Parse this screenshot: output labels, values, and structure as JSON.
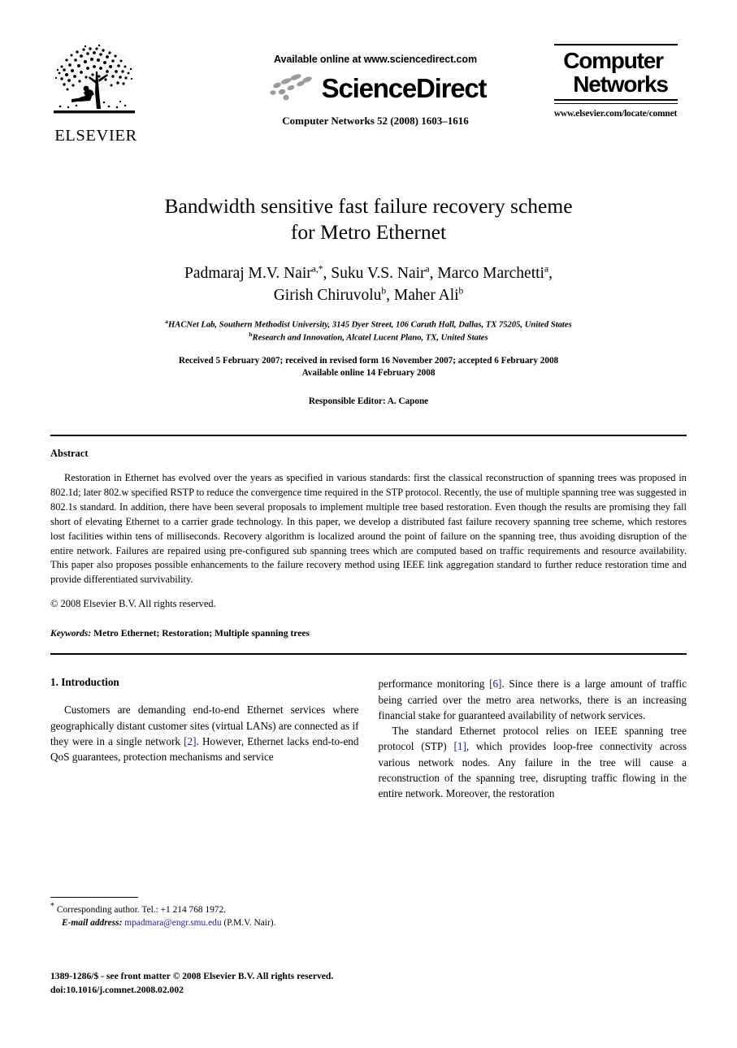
{
  "header": {
    "elsevier_wordmark": "ELSEVIER",
    "available_online": "Available online at www.sciencedirect.com",
    "sciencedirect_wordmark": "ScienceDirect",
    "journal_citation": "Computer Networks 52 (2008) 1603–1616",
    "journal_logo_line1": "Computer",
    "journal_logo_line2": "Networks",
    "journal_url": "www.elsevier.com/locate/comnet"
  },
  "title": {
    "line1": "Bandwidth sensitive fast failure recovery scheme",
    "line2": "for Metro Ethernet"
  },
  "authors": {
    "line1_parts": [
      {
        "name": "Padmaraj M.V. Nair",
        "sup": "a,*"
      },
      {
        "name": "Suku V.S. Nair",
        "sup": "a"
      },
      {
        "name": "Marco Marchetti",
        "sup": "a"
      }
    ],
    "line2_parts": [
      {
        "name": "Girish Chiruvolu",
        "sup": "b"
      },
      {
        "name": "Maher Ali",
        "sup": "b"
      }
    ]
  },
  "affiliations": [
    {
      "marker": "a",
      "text": "HACNet Lab, Southern Methodist University, 3145 Dyer Street, 106 Caruth Hall, Dallas, TX 75205, United States"
    },
    {
      "marker": "b",
      "text": "Research and Innovation, Alcatel Lucent Plano, TX, United States"
    }
  ],
  "history": {
    "received": "Received 5 February 2007; received in revised form 16 November 2007; accepted 6 February 2008",
    "available": "Available online 14 February 2008",
    "editor": "Responsible Editor: A. Capone"
  },
  "abstract": {
    "heading": "Abstract",
    "body": "Restoration in Ethernet has evolved over the years as specified in various standards: first the classical reconstruction of spanning trees was proposed in 802.1d; later 802.w specified RSTP to reduce the convergence time required in the STP protocol. Recently, the use of multiple spanning tree was suggested in 802.1s standard. In addition, there have been several proposals to implement multiple tree based restoration. Even though the results are promising they fall short of elevating Ethernet to a carrier grade technology. In this paper, we develop a distributed fast failure recovery spanning tree scheme, which restores lost facilities within tens of milliseconds. Recovery algorithm is localized around the point of failure on the spanning tree, thus avoiding disruption of the entire network. Failures are repaired using pre-configured sub spanning trees which are computed based on traffic requirements and resource availability. This paper also proposes possible enhancements to the failure recovery method using IEEE link aggregation standard to further reduce restoration time and provide differentiated survivability.",
    "copyright": "© 2008 Elsevier B.V. All rights reserved.",
    "keywords_label": "Keywords:",
    "keywords_values": "Metro Ethernet; Restoration; Multiple spanning trees"
  },
  "body": {
    "section1_heading": "1. Introduction",
    "left_par1_before": "Customers are demanding end-to-end Ethernet services where geographically distant customer sites (virtual LANs) are connected as if they were in a single network ",
    "left_par1_cite": "[2]",
    "left_par1_after": ". However, Ethernet lacks end-to-end QoS guarantees, protection mechanisms and service",
    "right_par1_before": "performance monitoring ",
    "right_par1_cite": "[6]",
    "right_par1_after": ". Since there is a large amount of traffic being carried over the metro area networks, there is an increasing financial stake for guaranteed availability of network services.",
    "right_par2_before": "The standard Ethernet protocol relies on IEEE spanning tree protocol (STP) ",
    "right_par2_cite": "[1]",
    "right_par2_after": ", which provides loop-free connectivity across various network nodes. Any failure in the tree will cause a reconstruction of the spanning tree, disrupting traffic flowing in the entire network. Moreover, the restoration"
  },
  "footnote": {
    "star": "*",
    "corresponding": "Corresponding author. Tel.: +1 214 768 1972.",
    "email_label": "E-mail address:",
    "email": "mpadmara@engr.smu.edu",
    "email_owner": "(P.M.V. Nair)."
  },
  "page_footer": {
    "line1": "1389-1286/$ - see front matter © 2008 Elsevier B.V. All rights reserved.",
    "line2": "doi:10.1016/j.comnet.2008.02.002"
  },
  "colors": {
    "link": "#1a1a8c",
    "swoosh": "#9a9a9a"
  }
}
